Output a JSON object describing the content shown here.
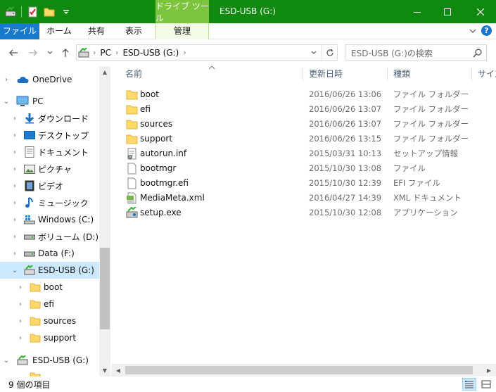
{
  "window": {
    "title": "ESD-USB (G:)",
    "context_tool_label": "ドライブ ツール",
    "qat_icons": [
      "usb-drive-icon",
      "properties-icon",
      "new-folder-icon",
      "customize-qat-icon"
    ],
    "controls": [
      "minimize-icon",
      "maximize-icon",
      "close-icon"
    ]
  },
  "ribbon": {
    "tabs": [
      "ファイル",
      "ホーム",
      "共有",
      "表示",
      "管理"
    ],
    "help_label": "?"
  },
  "navbar": {
    "breadcrumb": [
      "PC",
      "ESD-USB (G:)"
    ],
    "search_placeholder": "ESD-USB (G:)の検索"
  },
  "nav_pane": {
    "items": [
      {
        "label": "OneDrive",
        "icon": "cloud-icon",
        "expanded": false
      },
      {
        "label": "PC",
        "icon": "computer-icon",
        "expanded": true
      },
      {
        "label": "ダウンロード",
        "icon": "download-icon",
        "expanded": false
      },
      {
        "label": "デスクトップ",
        "icon": "desktop-icon",
        "expanded": false
      },
      {
        "label": "ドキュメント",
        "icon": "documents-icon",
        "expanded": false
      },
      {
        "label": "ピクチャ",
        "icon": "pictures-icon",
        "expanded": false
      },
      {
        "label": "ビデオ",
        "icon": "videos-icon",
        "expanded": false
      },
      {
        "label": "ミュージック",
        "icon": "music-icon",
        "expanded": false
      },
      {
        "label": "Windows (C:)",
        "icon": "windows-drive-icon",
        "expanded": false
      },
      {
        "label": "ボリューム (D:)",
        "icon": "drive-icon",
        "expanded": false
      },
      {
        "label": "Data (F:)",
        "icon": "drive-icon",
        "expanded": false
      },
      {
        "label": "ESD-USB (G:)",
        "icon": "usb-drive-icon",
        "expanded": true,
        "selected": true
      },
      {
        "label": "boot",
        "icon": "folder-icon",
        "expanded": false
      },
      {
        "label": "efi",
        "icon": "folder-icon",
        "expanded": false
      },
      {
        "label": "sources",
        "icon": "folder-icon",
        "expanded": false
      },
      {
        "label": "support",
        "icon": "folder-icon",
        "expanded": false
      },
      {
        "label": "ESD-USB (G:)",
        "icon": "usb-drive-icon",
        "expanded": true
      }
    ]
  },
  "file_list": {
    "columns": [
      "名前",
      "更新日時",
      "種類",
      "サイズ"
    ],
    "rows": [
      {
        "name": "boot",
        "date": "2016/06/26 13:06",
        "type": "ファイル フォルダー",
        "icon": "folder-icon"
      },
      {
        "name": "efi",
        "date": "2016/06/26 13:07",
        "type": "ファイル フォルダー",
        "icon": "folder-icon"
      },
      {
        "name": "sources",
        "date": "2016/06/26 13:07",
        "type": "ファイル フォルダー",
        "icon": "folder-icon"
      },
      {
        "name": "support",
        "date": "2016/06/26 13:15",
        "type": "ファイル フォルダー",
        "icon": "folder-icon"
      },
      {
        "name": "autorun.inf",
        "date": "2015/03/31 10:13",
        "type": "セットアップ情報",
        "icon": "setup-info-icon"
      },
      {
        "name": "bootmgr",
        "date": "2015/10/30 13:08",
        "type": "ファイル",
        "icon": "file-icon"
      },
      {
        "name": "bootmgr.efi",
        "date": "2015/10/30 12:39",
        "type": "EFI ファイル",
        "icon": "file-icon"
      },
      {
        "name": "MediaMeta.xml",
        "date": "2016/04/27 14:39",
        "type": "XML ドキュメント",
        "icon": "xml-document-icon"
      },
      {
        "name": "setup.exe",
        "date": "2015/10/30 12:08",
        "type": "アプリケーション",
        "icon": "setup-exe-icon"
      }
    ]
  },
  "status_bar": {
    "item_count": "9 個の項目",
    "views": [
      "details-view-icon",
      "large-icons-view-icon"
    ]
  },
  "colors": {
    "titlebar": "#0f8a0f",
    "context_tab": "#7cc43d",
    "file_tab": "#1979ca",
    "selection": "#cce8ff",
    "folder": "#ffd96a"
  }
}
